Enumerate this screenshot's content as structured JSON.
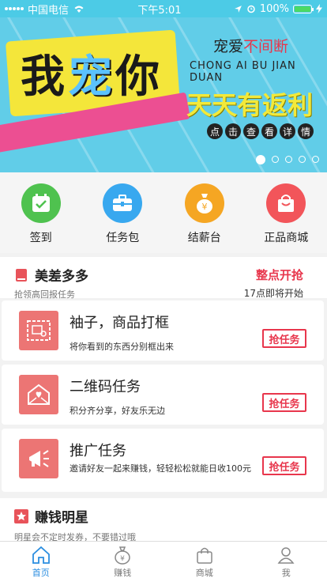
{
  "status_bar": {
    "carrier": "中国电信",
    "time": "下午5:01",
    "battery": "100%"
  },
  "banner": {
    "big_text": [
      "我",
      "宠",
      "你"
    ],
    "slogan_a": "宠爱",
    "slogan_b": "不间断",
    "pinyin": "CHONG AI BU JIAN DUAN",
    "daily": "天天有返利",
    "detail_chars": [
      "点",
      "击",
      "查",
      "看",
      "详",
      "情"
    ]
  },
  "quick_nav": [
    {
      "label": "签到",
      "color": "#4fc24f"
    },
    {
      "label": "任务包",
      "color": "#38a8ef"
    },
    {
      "label": "结薪台",
      "color": "#f5a623"
    },
    {
      "label": "正品商城",
      "color": "#f2555a"
    }
  ],
  "section1": {
    "title": "美差多多",
    "subtitle": "抢领高回报任务",
    "right_title": "整点开抢",
    "right_sub": "17点即将开始"
  },
  "tasks": [
    {
      "title": "袖子，商品打框",
      "desc": "将你看到的东西分别框出来",
      "btn": "抢任务"
    },
    {
      "title": "二维码任务",
      "desc": "积分齐分享，好友乐无边",
      "btn": "抢任务"
    },
    {
      "title": "推广任务",
      "desc": "邀请好友一起来赚钱，轻轻松松就能日收100元",
      "btn": "抢任务"
    }
  ],
  "section2": {
    "title": "赚钱明星",
    "subtitle": "明星会不定时发券，不要错过哦"
  },
  "tabbar": [
    {
      "label": "首页",
      "active": true
    },
    {
      "label": "赚钱",
      "active": false
    },
    {
      "label": "商城",
      "active": false
    },
    {
      "label": "我",
      "active": false
    }
  ]
}
